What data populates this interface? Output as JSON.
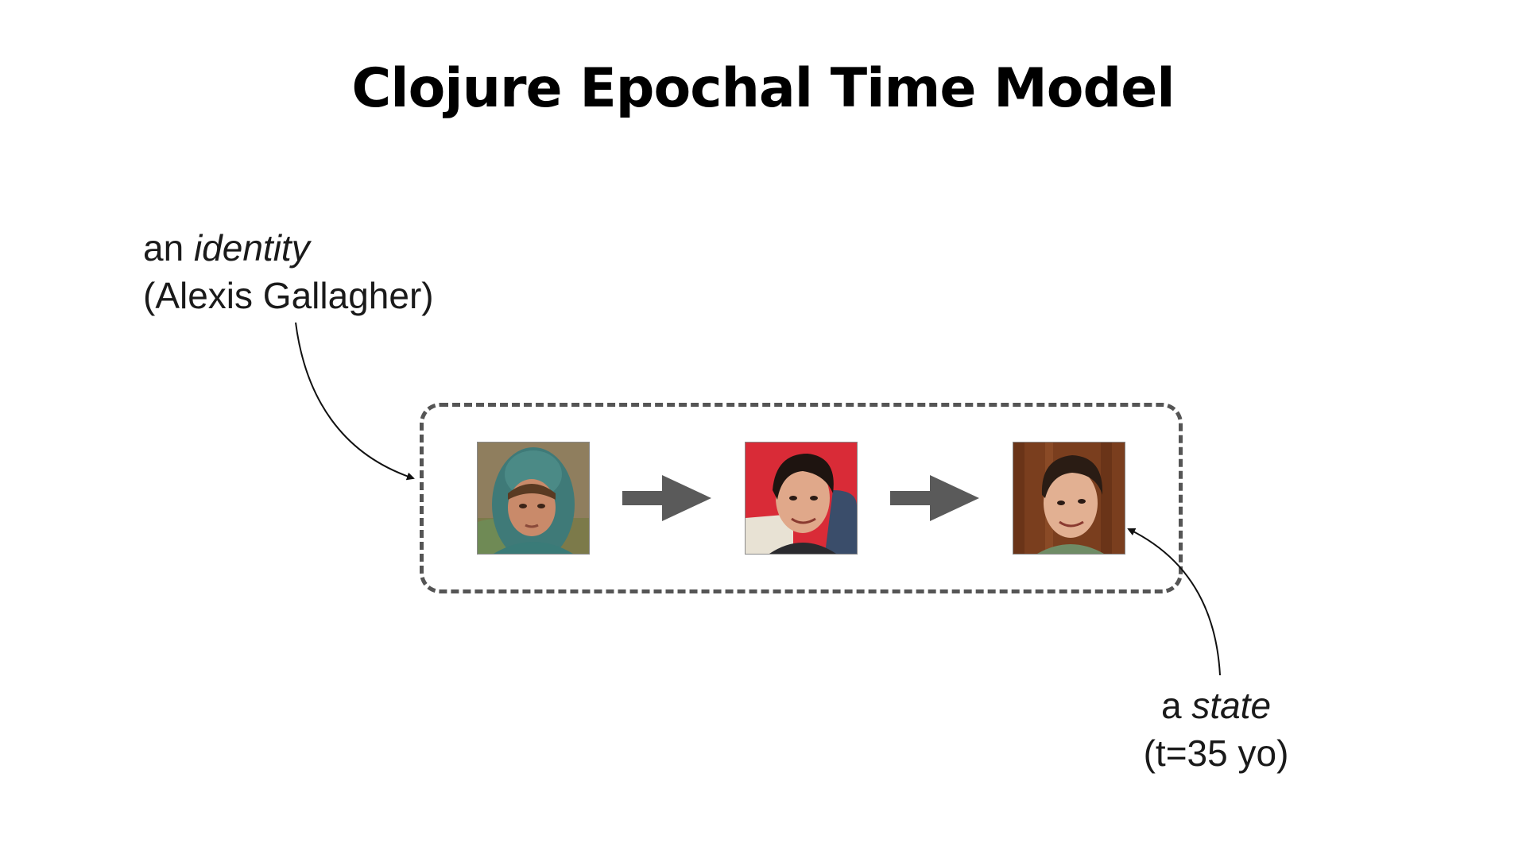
{
  "slide": {
    "title": "Clojure Epochal Time Model"
  },
  "identity_label": {
    "prefix": "an ",
    "term": "identity",
    "name": "(Alexis Gallagher)"
  },
  "state_label": {
    "prefix": "a ",
    "term": "state",
    "detail": "(t=35 yo)"
  },
  "timeline": {
    "states": [
      {
        "icon": "child-portrait-photo"
      },
      {
        "icon": "young-adult-portrait-photo"
      },
      {
        "icon": "adult-portrait-photo"
      }
    ],
    "transition_icon": "right-arrow-icon"
  },
  "colors": {
    "frame": "#555555",
    "arrow": "#5a5a5a",
    "text": "#1a1a1a"
  }
}
